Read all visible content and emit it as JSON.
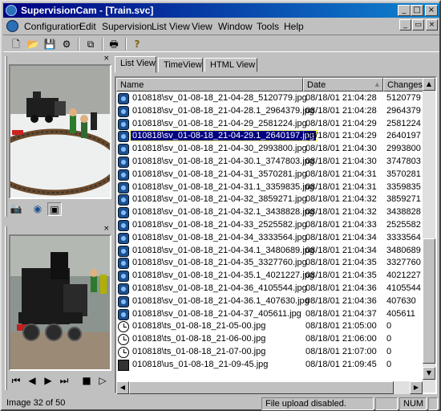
{
  "window": {
    "title": "SupervisionCam - [Train.svc]",
    "min_glyph": "_",
    "max_glyph": "□",
    "close_glyph": "×",
    "restore_glyph": "▭"
  },
  "menu": [
    "Configuration",
    "Edit",
    "Supervision",
    "List View",
    "View",
    "Window",
    "Tools",
    "Help"
  ],
  "toolbar": [
    {
      "icon": "new-file-icon",
      "glyph": "🗋"
    },
    {
      "icon": "open-folder-icon",
      "glyph": "📂"
    },
    {
      "icon": "save-icon",
      "glyph": "💾"
    },
    {
      "icon": "tools-icon",
      "glyph": "⚙"
    },
    {
      "icon": "copy-icon",
      "glyph": "⧉"
    },
    {
      "icon": "print-icon",
      "glyph": "🖶"
    },
    {
      "icon": "help-icon",
      "glyph": "?"
    }
  ],
  "panels": {
    "close_glyph": "×",
    "preview_icons": [
      {
        "icon": "camera-icon",
        "glyph": "📷"
      },
      {
        "icon": "webcam-icon",
        "glyph": "◉"
      },
      {
        "icon": "film-icon",
        "glyph": "▣"
      }
    ],
    "playback": [
      {
        "icon": "first-frame-icon",
        "glyph": "⏮"
      },
      {
        "icon": "previous-frame-icon",
        "glyph": "◀"
      },
      {
        "icon": "next-frame-icon",
        "glyph": "▶"
      },
      {
        "icon": "last-frame-icon",
        "glyph": "⏭"
      },
      {
        "icon": "stop-icon",
        "glyph": "■"
      },
      {
        "icon": "play-icon",
        "glyph": "▷"
      }
    ]
  },
  "tabs": [
    "List View",
    "TimeView",
    "HTML View"
  ],
  "columns": {
    "name": "Name",
    "date": "Date",
    "changes": "Changes",
    "sort_glyph": "▲"
  },
  "rows": [
    {
      "icon": "cam",
      "name": "010818\\sv_01-08-18_21-04-28_5120779.jpg",
      "date": "08/18/01 21:04:28",
      "changes": "5120779"
    },
    {
      "icon": "cam",
      "name": "010818\\sv_01-08-18_21-04-28.1_2964379.jpg",
      "date": "08/18/01 21:04:28",
      "changes": "2964379"
    },
    {
      "icon": "cam",
      "name": "010818\\sv_01-08-18_21-04-29_2581224.jpg",
      "date": "08/18/01 21:04:29",
      "changes": "2581224"
    },
    {
      "icon": "cam",
      "name": "010818\\sv_01-08-18_21-04-29.1_2640197.jpg",
      "date": "08/18/01 21:04:29",
      "changes": "2640197"
    },
    {
      "icon": "cam",
      "name": "010818\\sv_01-08-18_21-04-30_2993800.jpg",
      "date": "08/18/01 21:04:30",
      "changes": "2993800"
    },
    {
      "icon": "cam",
      "name": "010818\\sv_01-08-18_21-04-30.1_3747803.jpg",
      "date": "08/18/01 21:04:30",
      "changes": "3747803"
    },
    {
      "icon": "cam",
      "name": "010818\\sv_01-08-18_21-04-31_3570281.jpg",
      "date": "08/18/01 21:04:31",
      "changes": "3570281"
    },
    {
      "icon": "cam",
      "name": "010818\\sv_01-08-18_21-04-31.1_3359835.jpg",
      "date": "08/18/01 21:04:31",
      "changes": "3359835"
    },
    {
      "icon": "cam",
      "name": "010818\\sv_01-08-18_21-04-32_3859271.jpg",
      "date": "08/18/01 21:04:32",
      "changes": "3859271"
    },
    {
      "icon": "cam",
      "name": "010818\\sv_01-08-18_21-04-32.1_3438828.jpg",
      "date": "08/18/01 21:04:32",
      "changes": "3438828"
    },
    {
      "icon": "cam",
      "name": "010818\\sv_01-08-18_21-04-33_2525582.jpg",
      "date": "08/18/01 21:04:33",
      "changes": "2525582"
    },
    {
      "icon": "cam",
      "name": "010818\\sv_01-08-18_21-04-34_3333564.jpg",
      "date": "08/18/01 21:04:34",
      "changes": "3333564"
    },
    {
      "icon": "cam",
      "name": "010818\\sv_01-08-18_21-04-34.1_3480689.jpg",
      "date": "08/18/01 21:04:34",
      "changes": "3480689"
    },
    {
      "icon": "cam",
      "name": "010818\\sv_01-08-18_21-04-35_3327760.jpg",
      "date": "08/18/01 21:04:35",
      "changes": "3327760"
    },
    {
      "icon": "cam",
      "name": "010818\\sv_01-08-18_21-04-35.1_4021227.jpg",
      "date": "08/18/01 21:04:35",
      "changes": "4021227"
    },
    {
      "icon": "cam",
      "name": "010818\\sv_01-08-18_21-04-36_4105544.jpg",
      "date": "08/18/01 21:04:36",
      "changes": "4105544"
    },
    {
      "icon": "cam",
      "name": "010818\\sv_01-08-18_21-04-36.1_407630.jpg",
      "date": "08/18/01 21:04:36",
      "changes": "407630"
    },
    {
      "icon": "cam",
      "name": "010818\\sv_01-08-18_21-04-37_405611.jpg",
      "date": "08/18/01 21:04:37",
      "changes": "405611"
    },
    {
      "icon": "clock",
      "name": "010818\\ts_01-08-18_21-05-00.jpg",
      "date": "08/18/01 21:05:00",
      "changes": "0"
    },
    {
      "icon": "clock",
      "name": "010818\\ts_01-08-18_21-06-00.jpg",
      "date": "08/18/01 21:06:00",
      "changes": "0"
    },
    {
      "icon": "clock",
      "name": "010818\\ts_01-08-18_21-07-00.jpg",
      "date": "08/18/01 21:07:00",
      "changes": "0"
    },
    {
      "icon": "film",
      "name": "010818\\us_01-08-18_21-09-45.jpg",
      "date": "08/18/01 21:09:45",
      "changes": "0"
    }
  ],
  "selected_row_index": 3,
  "scroll": {
    "up_glyph": "▲",
    "down_glyph": "▼",
    "left_glyph": "◀",
    "right_glyph": "▶"
  },
  "status": {
    "left": "Image 32 of 50",
    "middle": "File upload disabled.",
    "num": "NUM"
  }
}
